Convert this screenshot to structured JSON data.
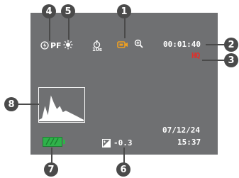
{
  "screen": {
    "counter": "00:01:40",
    "quality": "HQ",
    "date": "07/12/24",
    "time": "15:37",
    "exposure_value": "-0.3",
    "self_timer": "10s",
    "flash_mode": "PF"
  },
  "callouts": [
    "1",
    "2",
    "3",
    "4",
    "5",
    "6",
    "7",
    "8"
  ],
  "histogram": {
    "levels": [
      0.05,
      0.1,
      0.5,
      0.2,
      0.85,
      0.6,
      0.4,
      0.5,
      0.3,
      0.35,
      0.3,
      0.25,
      0.2,
      0.15,
      0.1,
      0.05
    ]
  },
  "battery": {
    "level": 1.0
  },
  "icons": {
    "flash": "flash-icon",
    "white_balance": "sun-icon",
    "self_timer": "timer-icon",
    "recording_mode": "movie-mode-icon",
    "zoom": "zoom-icon",
    "exposure": "ev-icon"
  },
  "colors": {
    "screen": "#6f7072",
    "battery": "#2fb24a",
    "recording_icon": "#f0a020",
    "quality": "#e0302a",
    "callout": "#4a4a4a"
  }
}
